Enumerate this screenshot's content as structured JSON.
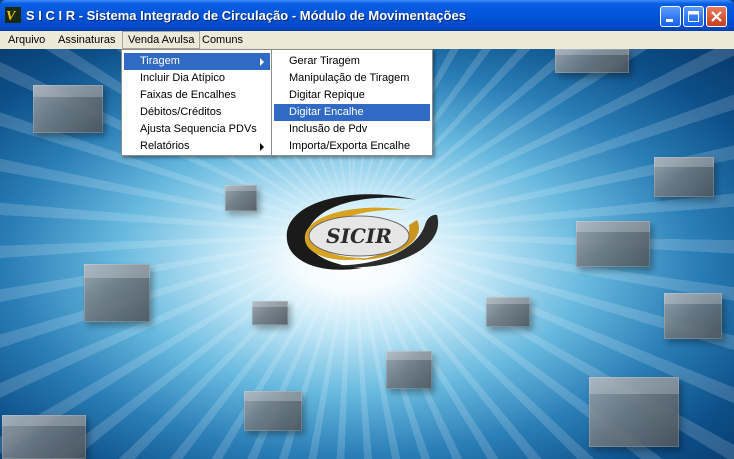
{
  "window": {
    "title": "S I C I R - Sistema Integrado de Circulação - Módulo de Movimentações",
    "app_icon": "sicir-app-icon",
    "controls": {
      "minimize": "minimize-icon",
      "maximize": "maximize-icon",
      "close": "close-icon"
    }
  },
  "menubar": {
    "items": [
      "Arquivo",
      "Assinaturas",
      "Venda Avulsa",
      "Comuns"
    ],
    "open_item": "Venda Avulsa"
  },
  "venda_menu": {
    "items": [
      {
        "label": "Tiragem",
        "has_submenu": true,
        "highlighted": true
      },
      {
        "label": "Incluir Dia Atípico",
        "has_submenu": false
      },
      {
        "label": "Faixas de Encalhes",
        "has_submenu": false
      },
      {
        "label": "Débitos/Créditos",
        "has_submenu": false
      },
      {
        "label": "Ajusta Sequencia PDVs",
        "has_submenu": false
      },
      {
        "label": "Relatórios",
        "has_submenu": true
      }
    ]
  },
  "tiragem_menu": {
    "items": [
      {
        "label": "Gerar Tiragem"
      },
      {
        "label": "Manipulação de Tiragem"
      },
      {
        "label": "Digitar Repique"
      },
      {
        "label": "Digitar Encalhe",
        "highlighted": true
      },
      {
        "label": "Inclusão de Pdv"
      },
      {
        "label": "Importa/Exporta Encalhe"
      }
    ]
  },
  "logo": {
    "text": "SICIR"
  },
  "colors": {
    "titlebar": "#0254d8",
    "menubar": "#ece9d8",
    "highlight": "#316ac5"
  }
}
